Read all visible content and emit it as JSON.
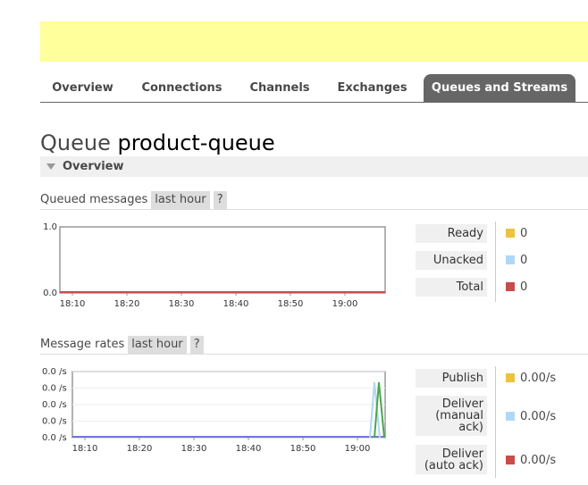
{
  "nav": {
    "tabs": [
      {
        "label": "Overview"
      },
      {
        "label": "Connections"
      },
      {
        "label": "Channels"
      },
      {
        "label": "Exchanges"
      },
      {
        "label": "Queues and Streams",
        "active": true
      }
    ]
  },
  "page": {
    "title_prefix": "Queue",
    "queue_name": "product-queue",
    "section_label": "Overview"
  },
  "queued_messages": {
    "heading": "Queued messages",
    "range_label": "last hour",
    "help_label": "?",
    "legend": [
      {
        "label": "Ready",
        "value": "0",
        "color": "#edc240"
      },
      {
        "label": "Unacked",
        "value": "0",
        "color": "#afd8f8"
      },
      {
        "label": "Total",
        "value": "0",
        "color": "#cb4b4b"
      }
    ]
  },
  "message_rates": {
    "heading": "Message rates",
    "range_label": "last hour",
    "help_label": "?",
    "legend": [
      {
        "label": "Publish",
        "value": "0.00/s",
        "color": "#edc240"
      },
      {
        "label": "Deliver\n(manual\nack)",
        "value": "0.00/s",
        "color": "#afd8f8"
      },
      {
        "label": "Deliver\n(auto ack)",
        "value": "0.00/s",
        "color": "#cb4b4b"
      }
    ]
  },
  "chart_data": [
    {
      "type": "line",
      "x_ticks": [
        "18:10",
        "18:20",
        "18:30",
        "18:40",
        "18:50",
        "19:00"
      ],
      "y_ticks": [
        "0.0",
        "1.0"
      ],
      "ylim": [
        0,
        1
      ],
      "series": [
        {
          "name": "Ready",
          "color": "#edc240",
          "values": [
            0,
            0
          ]
        },
        {
          "name": "Unacked",
          "color": "#afd8f8",
          "values": [
            0,
            0
          ]
        },
        {
          "name": "Total",
          "color": "#cb4b4b",
          "values": [
            0,
            0
          ]
        }
      ]
    },
    {
      "type": "line",
      "x_ticks": [
        "18:10",
        "18:20",
        "18:30",
        "18:40",
        "18:50",
        "19:00"
      ],
      "y_ticks": [
        "0.0 /s",
        "0.0 /s",
        "0.0 /s",
        "0.0 /s",
        "0.0 /s"
      ],
      "series": [
        {
          "name": "Publish",
          "color": "#edc240"
        },
        {
          "name": "Deliver (manual ack)",
          "color": "#afd8f8"
        },
        {
          "name": "Deliver (auto ack)",
          "color": "#cb4b4b"
        }
      ],
      "spikes": [
        {
          "color": "#afd8f8"
        },
        {
          "color": "#4da74d"
        }
      ]
    }
  ]
}
